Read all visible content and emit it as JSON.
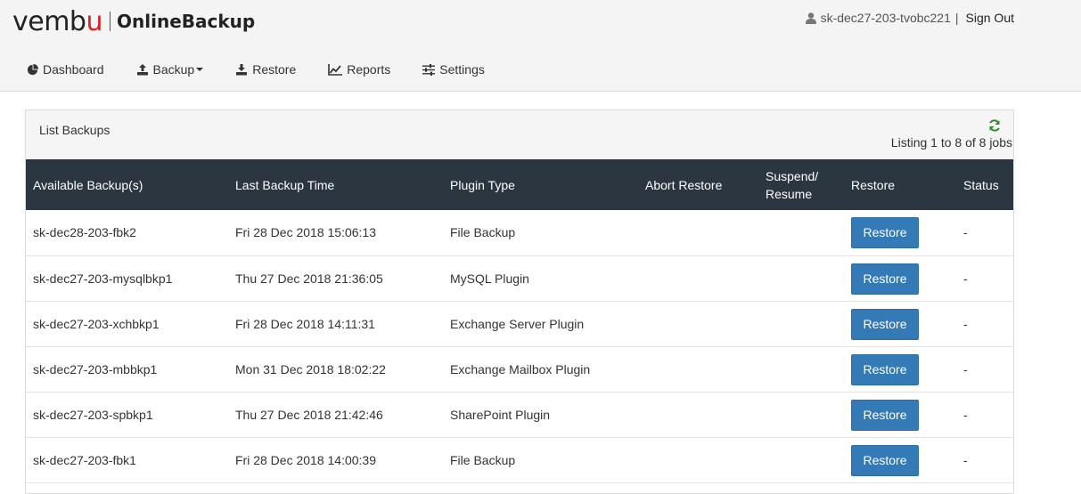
{
  "brand": {
    "word_prefix": "vemb",
    "word_accent": "u",
    "product": "OnlineBackup"
  },
  "user": {
    "name": "sk-dec27-203-tvobc221",
    "separator": "|",
    "signout": "Sign Out"
  },
  "nav": {
    "dashboard": "Dashboard",
    "backup": "Backup",
    "restore": "Restore",
    "reports": "Reports",
    "settings": "Settings"
  },
  "panel": {
    "title": "List Backups",
    "listing": "Listing 1 to 8 of 8 jobs"
  },
  "table": {
    "headers": {
      "available": "Available Backup(s)",
      "last_time": "Last Backup Time",
      "plugin": "Plugin Type",
      "abort": "Abort Restore",
      "suspend_line1": "Suspend/",
      "suspend_line2": "Resume",
      "restore": "Restore",
      "status": "Status"
    },
    "rows": [
      {
        "name": "sk-dec28-203-fbk2",
        "time": "Fri 28 Dec 2018 15:06:13",
        "plugin": "File Backup",
        "abort": "",
        "suspend": "",
        "restore_label": "Restore",
        "status": "-"
      },
      {
        "name": "sk-dec27-203-mysqlbkp1",
        "time": "Thu 27 Dec 2018 21:36:05",
        "plugin": "MySQL Plugin",
        "abort": "",
        "suspend": "",
        "restore_label": "Restore",
        "status": "-"
      },
      {
        "name": "sk-dec27-203-xchbkp1",
        "time": "Fri 28 Dec 2018 14:11:31",
        "plugin": "Exchange Server Plugin",
        "abort": "",
        "suspend": "",
        "restore_label": "Restore",
        "status": "-"
      },
      {
        "name": "sk-dec27-203-mbbkp1",
        "time": "Mon 31 Dec 2018 18:02:22",
        "plugin": "Exchange Mailbox Plugin",
        "abort": "",
        "suspend": "",
        "restore_label": "Restore",
        "status": "-"
      },
      {
        "name": "sk-dec27-203-spbkp1",
        "time": "Thu 27 Dec 2018 21:42:46",
        "plugin": "SharePoint Plugin",
        "abort": "",
        "suspend": "",
        "restore_label": "Restore",
        "status": "-"
      },
      {
        "name": "sk-dec27-203-fbk1",
        "time": "Fri 28 Dec 2018 14:00:39",
        "plugin": "File Backup",
        "abort": "",
        "suspend": "",
        "restore_label": "Restore",
        "status": "-"
      }
    ]
  },
  "colors": {
    "header_bg": "#2b3641",
    "button": "#337ab7",
    "refresh": "#2e8b2e",
    "logo_accent": "#e02020"
  }
}
